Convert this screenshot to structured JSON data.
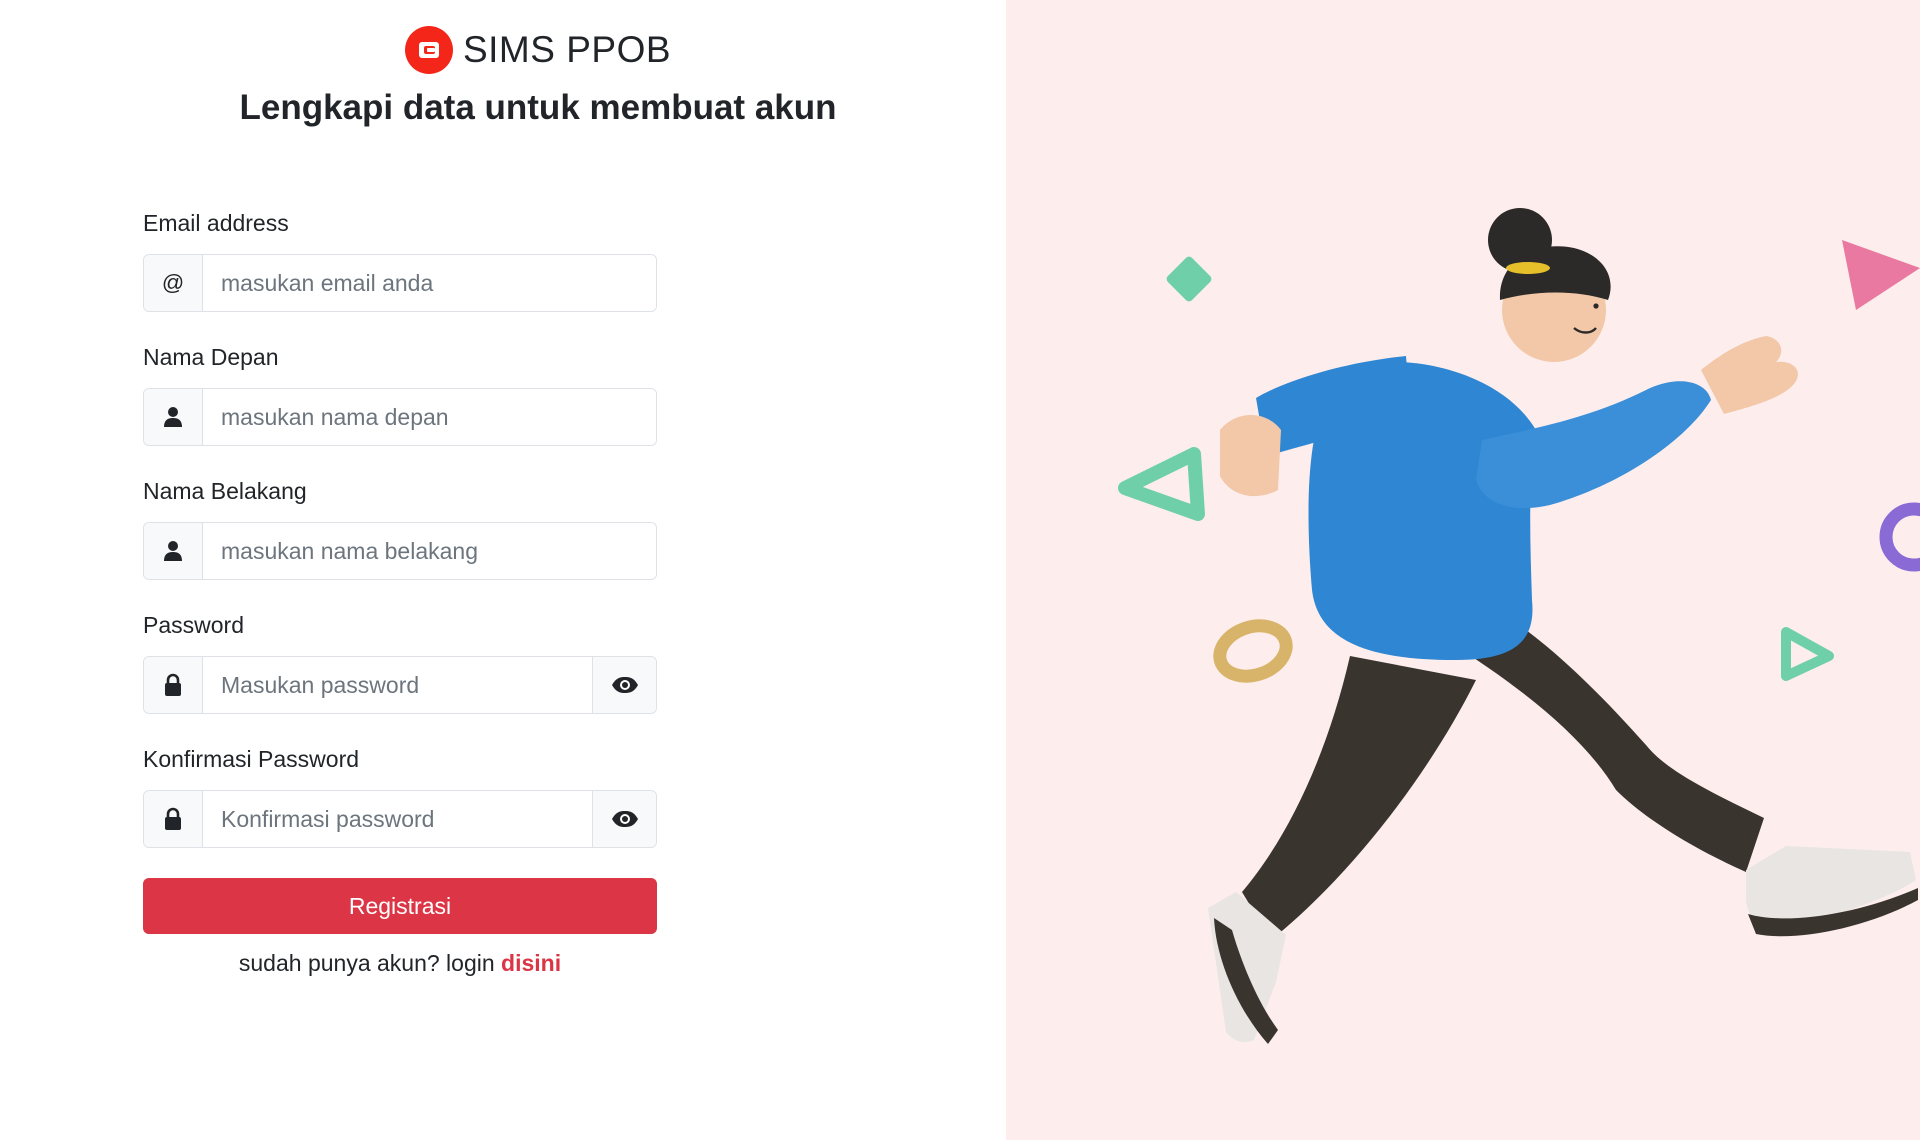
{
  "brand": {
    "name": "SIMS PPOB"
  },
  "heading": "Lengkapi data untuk membuat akun",
  "form": {
    "email": {
      "label": "Email address",
      "addon": "@",
      "placeholder": "masukan email anda"
    },
    "first_name": {
      "label": "Nama Depan",
      "placeholder": "masukan nama depan"
    },
    "last_name": {
      "label": "Nama Belakang",
      "placeholder": "masukan nama belakang"
    },
    "password": {
      "label": "Password",
      "placeholder": "Masukan password"
    },
    "confirm_password": {
      "label": "Konfirmasi Password",
      "placeholder": "Konfirmasi password"
    },
    "submit_label": "Registrasi"
  },
  "footer": {
    "text": "sudah punya akun? login ",
    "link": "disini"
  },
  "colors": {
    "accent": "#dc3545",
    "logo": "#f42619",
    "illustration_bg": "#fdeeed"
  }
}
